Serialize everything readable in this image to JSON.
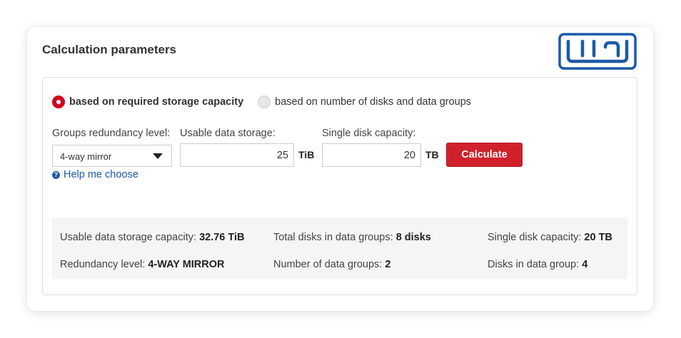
{
  "card": {
    "title": "Calculation parameters"
  },
  "logo": {
    "name": "brand-logo"
  },
  "mode": {
    "options": [
      {
        "label": "based on required storage capacity",
        "checked": true
      },
      {
        "label": "based on number of disks and data groups",
        "checked": false
      }
    ]
  },
  "form": {
    "redundancy_label": "Groups redundancy level:",
    "redundancy_value": "4-way mirror",
    "usable_label": "Usable data storage:",
    "usable_value": "25",
    "usable_unit": "TiB",
    "disk_label": "Single disk capacity:",
    "disk_value": "20",
    "disk_unit": "TB",
    "calculate_label": "Calculate",
    "help_label": "Help me choose"
  },
  "results": {
    "usable_capacity": {
      "label": "Usable data storage capacity:",
      "value": "32.76 TiB"
    },
    "total_disks": {
      "label": "Total disks in data groups:",
      "value": "8 disks"
    },
    "single_disk": {
      "label": "Single disk capacity:",
      "value": "20 TB"
    },
    "redundancy": {
      "label": "Redundancy level:",
      "value": "4-WAY MIRROR"
    },
    "data_groups": {
      "label": "Number of data groups:",
      "value": "2"
    },
    "disks_in_group": {
      "label": "Disks in data group:",
      "value": "4"
    }
  },
  "colors": {
    "accent": "#d0212b",
    "link": "#1c5aa8",
    "logo": "#1c5aa8"
  }
}
